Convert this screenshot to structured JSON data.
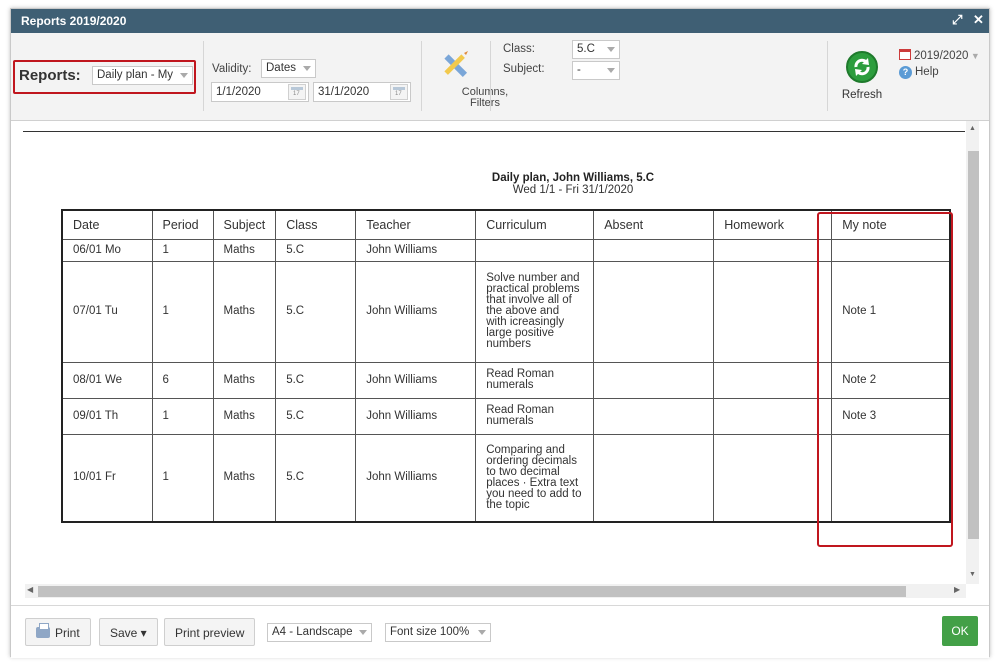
{
  "window": {
    "title": "Reports 2019/2020"
  },
  "toolbar": {
    "reports_label": "Reports:",
    "report_select": "Daily plan - My",
    "validity_label": "Validity:",
    "validity_select": "Dates",
    "date_from": "1/1/2020",
    "date_to": "31/1/2020",
    "columns_filters_label_1": "Columns,",
    "columns_filters_label_2": "Filters",
    "class_label": "Class:",
    "class_select": "5.C",
    "subject_label": "Subject:",
    "subject_select": "-",
    "refresh_label": "Refresh",
    "year_select": "2019/2020",
    "help_label": "Help"
  },
  "document": {
    "title": "Daily plan, John Williams, 5.C",
    "subtitle": "Wed 1/1 - Fri 31/1/2020",
    "columns": [
      "Date",
      "Period",
      "Subject",
      "Class",
      "Teacher",
      "Curriculum",
      "Absent",
      "Homework",
      "My note"
    ],
    "rows": [
      {
        "date": "06/01 Mo",
        "period": "1",
        "subject": "Maths",
        "class": "5.C",
        "teacher": "John Williams",
        "curriculum": [],
        "absent": "",
        "homework": "",
        "note": ""
      },
      {
        "date": "07/01 Tu",
        "period": "1",
        "subject": "Maths",
        "class": "5.C",
        "teacher": "John Williams",
        "curriculum": [
          "Solve number and",
          "practical problems",
          "that involve all of",
          "the above and",
          "with icreasingly",
          "large positive",
          "numbers"
        ],
        "absent": "",
        "homework": "",
        "note": "Note 1"
      },
      {
        "date": "08/01 We",
        "period": "6",
        "subject": "Maths",
        "class": "5.C",
        "teacher": "John Williams",
        "curriculum": [
          "Read Roman",
          "numerals"
        ],
        "absent": "",
        "homework": "",
        "note": "Note 2"
      },
      {
        "date": "09/01 Th",
        "period": "1",
        "subject": "Maths",
        "class": "5.C",
        "teacher": "John Williams",
        "curriculum": [
          "Read Roman",
          "numerals"
        ],
        "absent": "",
        "homework": "",
        "note": "Note 3"
      },
      {
        "date": "10/01 Fr",
        "period": "1",
        "subject": "Maths",
        "class": "5.C",
        "teacher": "John Williams",
        "curriculum": [
          "Comparing and",
          "ordering decimals",
          "to two decimal",
          "places · Extra text",
          "you need to add to",
          "the topic"
        ],
        "absent": "",
        "homework": "",
        "note": ""
      }
    ]
  },
  "footer": {
    "print_label": "Print",
    "save_label": "Save ▾",
    "print_preview_label": "Print preview",
    "paper_select": "A4 - Landscape",
    "font_size_select": "Font size 100%",
    "ok_label": "OK"
  },
  "colors": {
    "titlebar": "#3f5f74",
    "highlight": "#c0161e",
    "ok": "#43a047",
    "refresh": "#2c9d3d"
  }
}
